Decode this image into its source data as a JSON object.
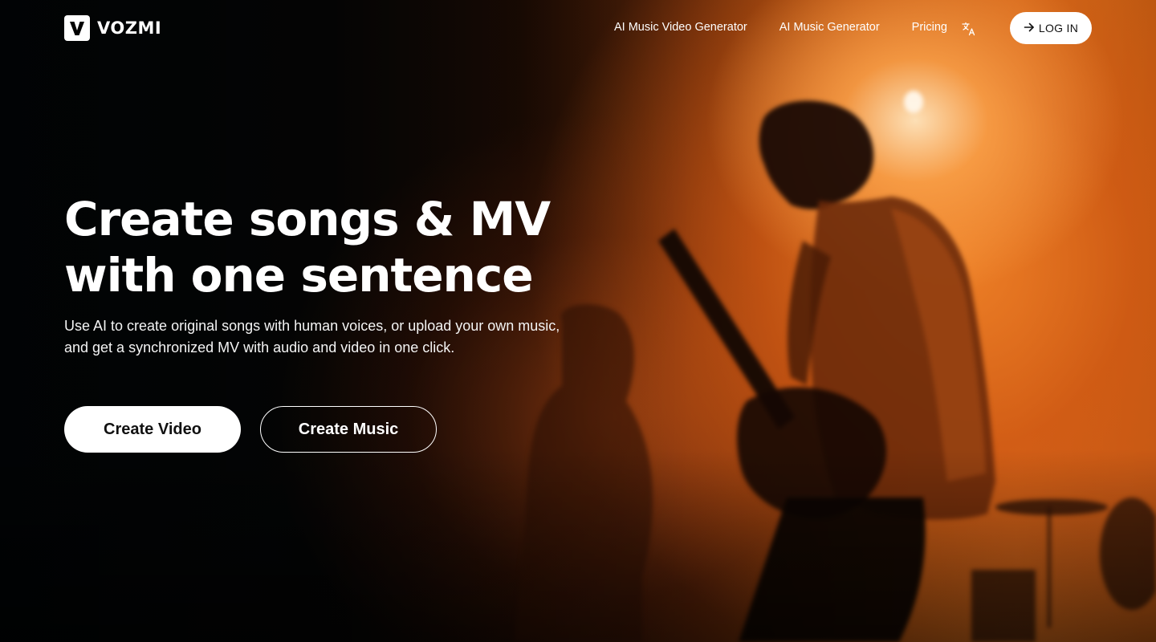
{
  "brand": {
    "name": "VOZMI",
    "logo_letter": "V"
  },
  "nav": {
    "items": [
      {
        "label": "AI Music Video Generator"
      },
      {
        "label": "AI Music Generator"
      },
      {
        "label": "Pricing"
      }
    ],
    "language_icon": "translate-icon",
    "login_label": "LOG IN",
    "login_icon": "arrow-right-icon"
  },
  "hero": {
    "title_line1": "Create songs & MV",
    "title_line2": "with one sentence",
    "subtitle": "Use AI to create original songs with human voices, or upload your own music, and get a synchronized MV with audio and video in one click.",
    "primary_cta": "Create Video",
    "secondary_cta": "Create Music"
  },
  "colors": {
    "accent_orange": "#d8711d",
    "background_dark": "#060707",
    "button_bg": "#ffffff",
    "button_text": "#111111"
  }
}
